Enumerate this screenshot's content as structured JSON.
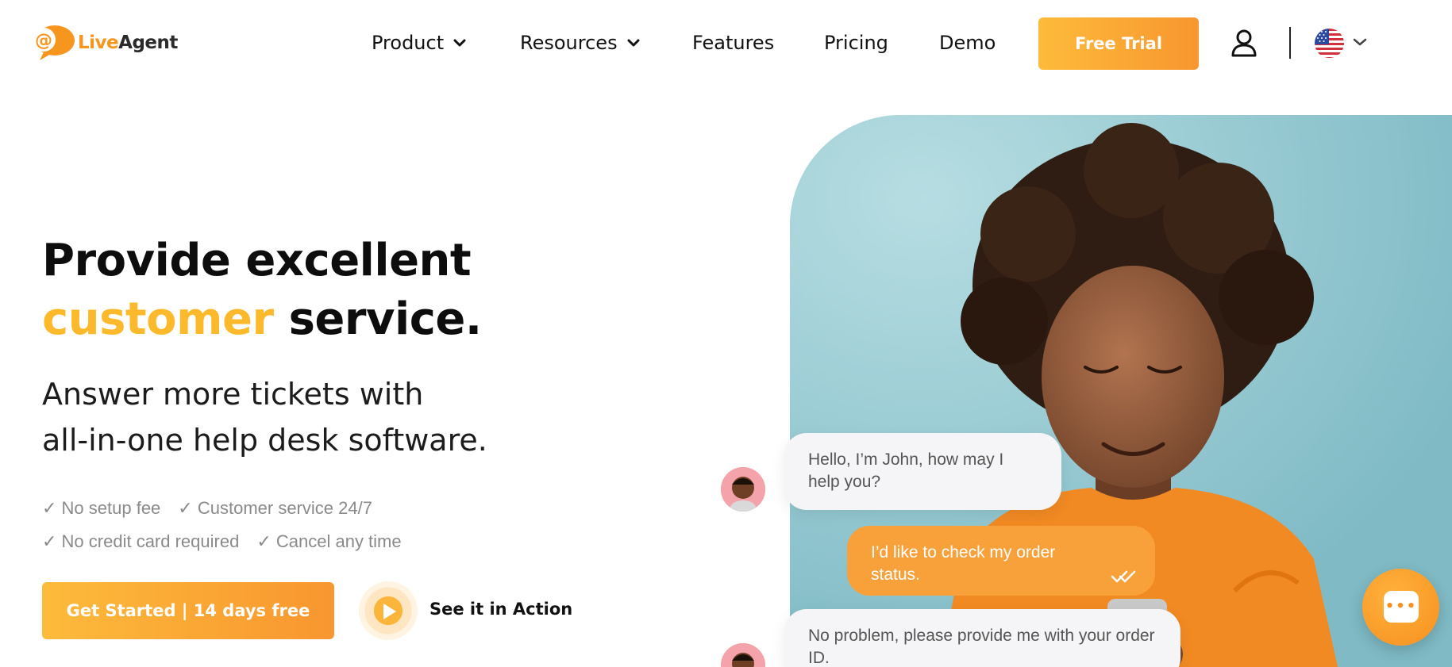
{
  "header": {
    "logo": {
      "live": "Live",
      "agent": "Agent",
      "icon": "at-sign-bubble-icon"
    },
    "nav": [
      {
        "label": "Product",
        "has_dropdown": true
      },
      {
        "label": "Resources",
        "has_dropdown": true
      },
      {
        "label": "Features",
        "has_dropdown": false
      },
      {
        "label": "Pricing",
        "has_dropdown": false
      },
      {
        "label": "Demo",
        "has_dropdown": false
      }
    ],
    "cta_label": "Free Trial",
    "account_icon": "user-icon",
    "language_icon": "us-flag-icon"
  },
  "hero": {
    "headline_line1": "Provide excellent",
    "headline_accent": "customer",
    "headline_rest": " service.",
    "subline_line1": "Answer more tickets with",
    "subline_line2": "all-in-one help desk software.",
    "checks": [
      [
        "✓ No setup fee",
        "✓ Customer service 24/7"
      ],
      [
        "✓ No credit card required",
        "✓ Cancel any time"
      ]
    ],
    "primary_button": "Get Started | 14 days free",
    "secondary_link": "See it in Action"
  },
  "chat": {
    "messages": [
      {
        "from": "agent",
        "text": "Hello, I’m John, how may I help you?"
      },
      {
        "from": "user",
        "text": "I’d like to check my order status."
      },
      {
        "from": "agent",
        "text": "No problem, please provide me with your order ID."
      }
    ]
  },
  "colors": {
    "accent": "#fcb92b",
    "button_start": "#fdbb3b",
    "button_end": "#f8962f",
    "photo_bg": "#8fc7d0",
    "user_bubble": "#f8a13a"
  }
}
